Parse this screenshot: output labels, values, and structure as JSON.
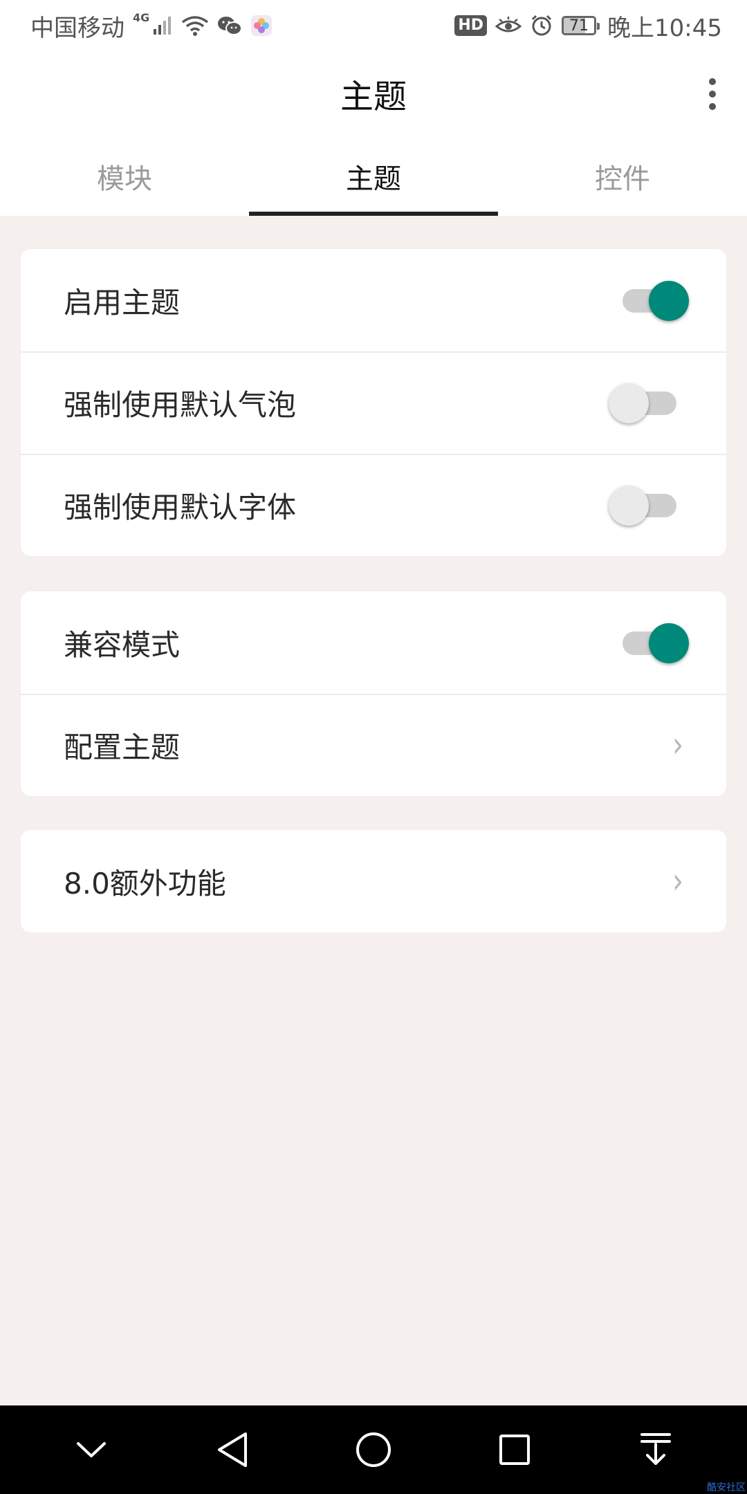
{
  "status_bar": {
    "carrier": "中国移动",
    "network": "4G",
    "hd": "HD",
    "battery": "71",
    "time": "晚上10:45"
  },
  "app_bar": {
    "title": "主题",
    "more_icon": "more-vertical-icon"
  },
  "tabs": [
    {
      "label": "模块",
      "active": false
    },
    {
      "label": "主题",
      "active": true
    },
    {
      "label": "控件",
      "active": false
    }
  ],
  "groups": [
    {
      "rows": [
        {
          "label": "启用主题",
          "type": "switch",
          "on": true
        },
        {
          "label": "强制使用默认气泡",
          "type": "switch",
          "on": false
        },
        {
          "label": "强制使用默认字体",
          "type": "switch",
          "on": false
        }
      ]
    },
    {
      "rows": [
        {
          "label": "兼容模式",
          "type": "switch",
          "on": true
        },
        {
          "label": "配置主题",
          "type": "link"
        }
      ]
    },
    {
      "rows": [
        {
          "label": "8.0额外功能",
          "type": "link"
        }
      ]
    }
  ],
  "colors": {
    "accent": "#00897b",
    "background": "#f5efee"
  },
  "nav_bar": {
    "buttons": [
      "collapse-icon",
      "back-icon",
      "home-icon",
      "recents-icon",
      "notification-pull-icon"
    ]
  },
  "watermark": "酷安社区"
}
